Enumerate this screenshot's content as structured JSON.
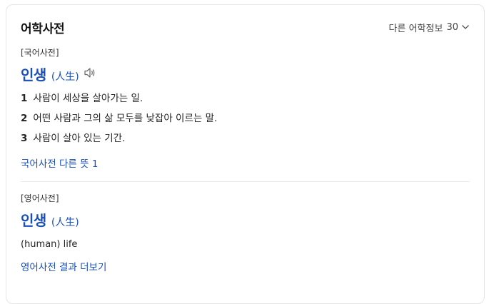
{
  "header": {
    "title": "어학사전",
    "more_label": "다른 어학정보",
    "more_count": "30"
  },
  "korean_dict": {
    "source": "[국어사전]",
    "word": "인생",
    "hanja": "(人生)",
    "definitions": [
      {
        "num": "1",
        "text": "사람이 세상을 살아가는 일."
      },
      {
        "num": "2",
        "text": "어떤 사람과 그의 삶 모두를 낮잡아 이르는 말."
      },
      {
        "num": "3",
        "text": "사람이 살아 있는 기간."
      }
    ],
    "more_link": "국어사전 다른 뜻 1"
  },
  "english_dict": {
    "source": "[영어사전]",
    "word": "인생",
    "hanja": "(人生)",
    "meaning": "(human) life",
    "more_link": "영어사전 결과 더보기"
  },
  "colors": {
    "link": "#1a4fb8",
    "text": "#222222",
    "border": "#e3e5e8"
  },
  "icons": [
    "speaker-icon",
    "chevron-down-icon"
  ]
}
